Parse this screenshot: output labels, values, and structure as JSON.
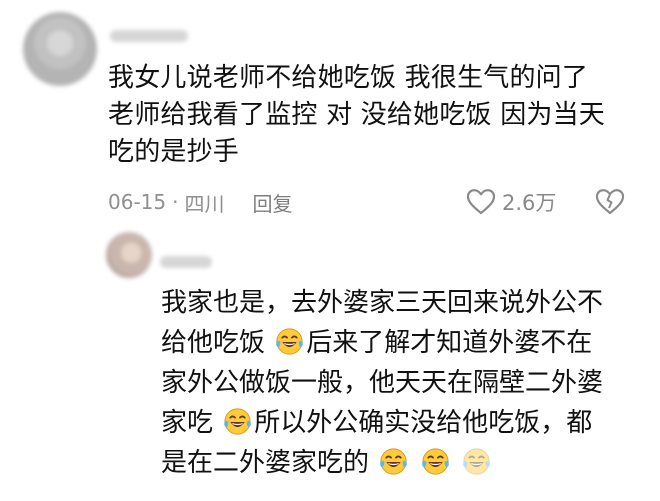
{
  "comment": {
    "lines": [
      "我女儿说老师不给她吃饭 我很生气的问了",
      "老师给我看了监控 对 没给她吃饭 因为当天",
      "吃的是抄手"
    ],
    "date": "06-15",
    "separator": "·",
    "location": "四川",
    "reply_label": "回复",
    "likes": "2.6万",
    "icons": [
      "heart-outline-icon",
      "broken-heart-icon"
    ]
  },
  "reply": {
    "segments": [
      [
        "我家也是，去外婆家三天回来说外公不"
      ],
      [
        "给他吃饭",
        "",
        "后来了解才知道外婆不在"
      ],
      [
        "家外公做饭一般，他天天在隔壁二外婆"
      ],
      [
        "家吃",
        "",
        "所以外公确实没给他吃饭，都"
      ],
      [
        "是在二外婆家吃的"
      ]
    ],
    "emoji": "laughing-tears-emoji"
  },
  "colors": {
    "text": "#111111",
    "meta": "#8f8f8f",
    "emoji_face": "#ffcb3d",
    "emoji_tears": "#58b9f0"
  }
}
